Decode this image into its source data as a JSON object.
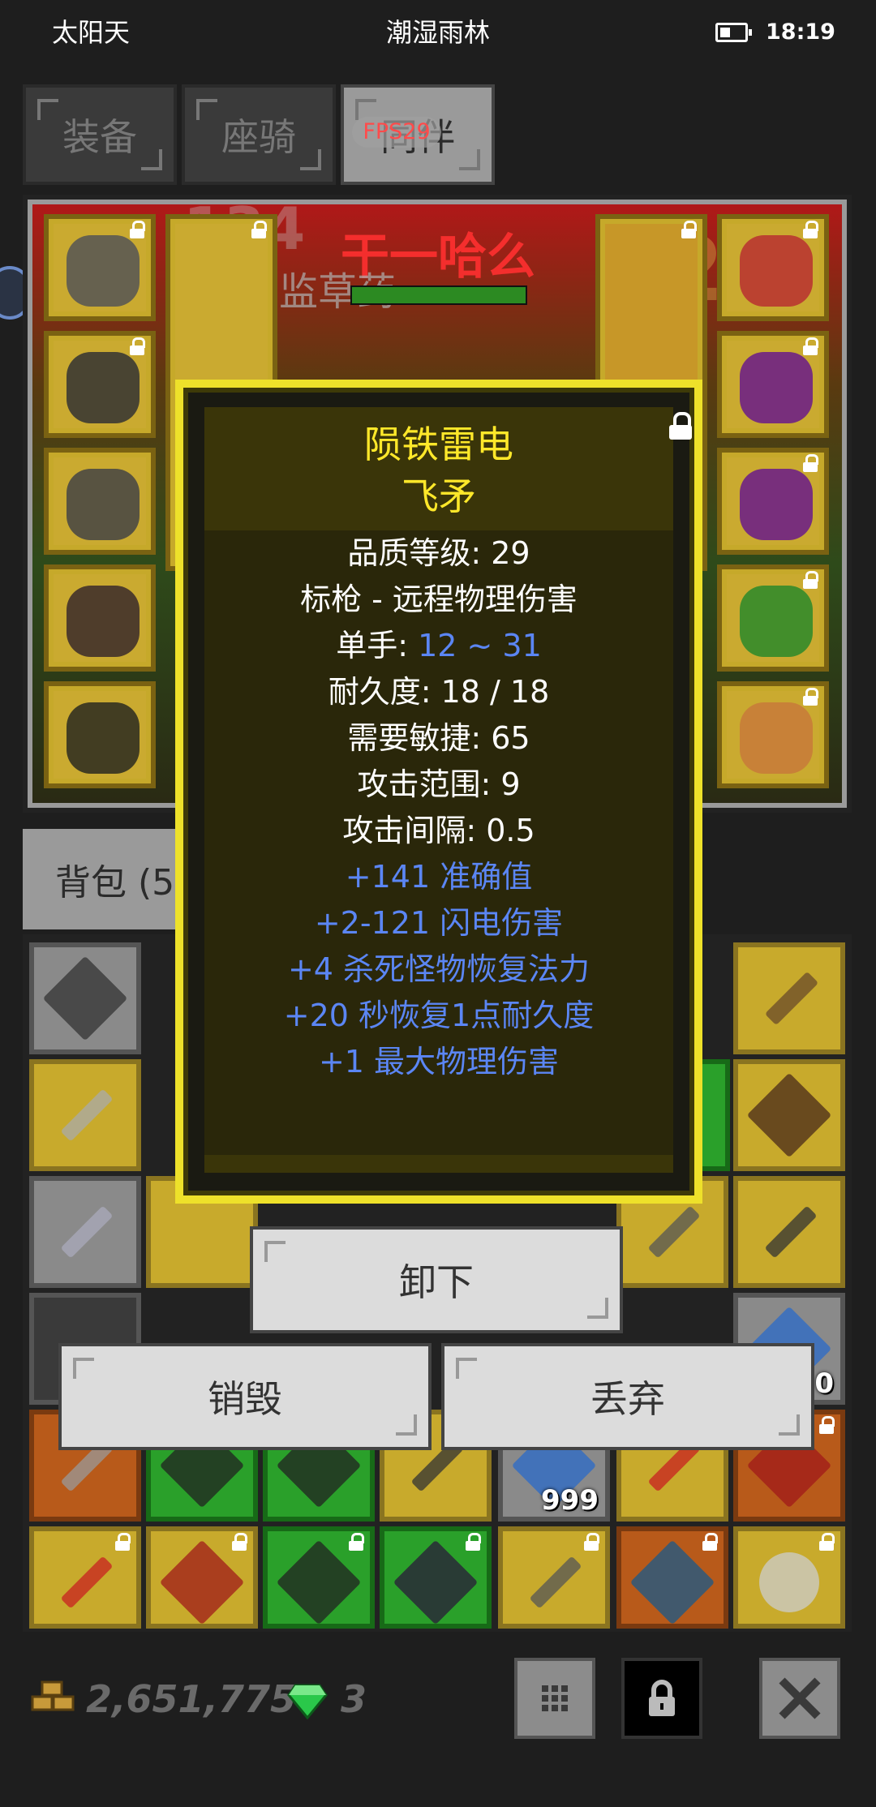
{
  "status_bar": {
    "weather": "太阳天",
    "location": "潮湿雨林",
    "time": "18:19"
  },
  "tabs": [
    {
      "label": "装备",
      "active": false
    },
    {
      "label": "座骑",
      "active": false
    },
    {
      "label": "同伴",
      "active": true
    }
  ],
  "fps": "FPS29",
  "equipment_view": {
    "target_name": "干一哈么",
    "target_sub": "监草药",
    "level_overlay": "134",
    "right_overlay": "22"
  },
  "bag": {
    "tab_label": "背包 (5",
    "quantities": [
      "999",
      "0"
    ]
  },
  "tooltip": {
    "name": "陨铁雷电",
    "type": "飞矛",
    "lines": [
      {
        "text": "品质等级: 29"
      },
      {
        "text": "标枪 - 远程物理伤害"
      },
      {
        "label": "单手: ",
        "value": "12 ~ 31"
      },
      {
        "text": "耐久度: 18 / 18"
      },
      {
        "text": "需要敏捷: 65"
      },
      {
        "text": "攻击范围: 9"
      },
      {
        "text": "攻击间隔: 0.5"
      }
    ],
    "bonuses": [
      "+141 准确值",
      "+2-121 闪电伤害",
      "+4 杀死怪物恢复法力",
      "+20 秒恢复1点耐久度",
      "+1 最大物理伤害"
    ]
  },
  "actions": {
    "unequip": "卸下",
    "destroy": "销毁",
    "drop": "丢弃"
  },
  "currency": {
    "gold": "2,651,775",
    "gems": "3"
  },
  "colors": {
    "tooltip_title": "#ffe82a",
    "bonus_blue": "#5b86f4",
    "tooltip_border": "#eee12a"
  }
}
